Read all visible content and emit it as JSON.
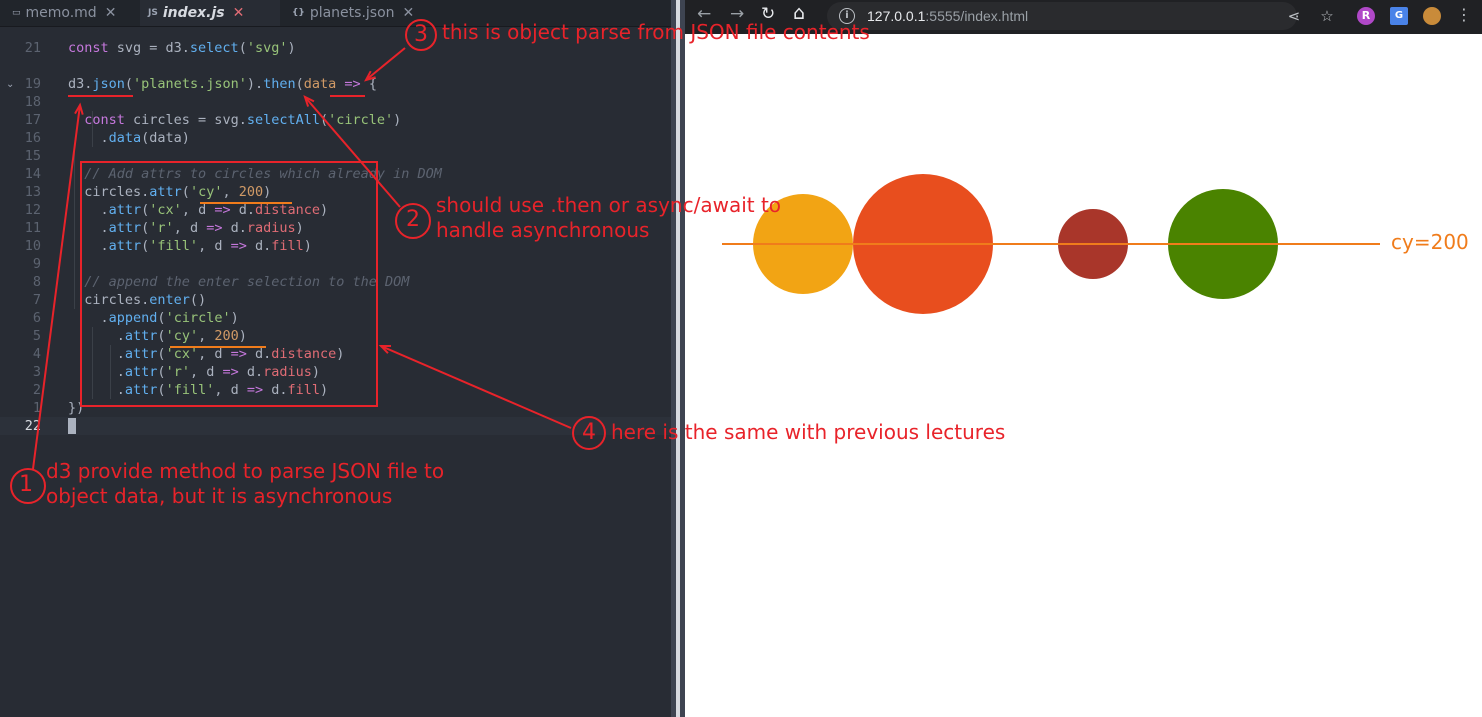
{
  "editor": {
    "tabs": [
      {
        "icon": "md-file-icon",
        "glyph": "▭",
        "label": "memo.md"
      },
      {
        "icon": "js-file-icon",
        "glyph": "JS",
        "label": "index.js"
      },
      {
        "icon": "json-file-icon",
        "glyph": "{}",
        "label": "planets.json"
      }
    ],
    "close_glyph": "✕",
    "lines": [
      {
        "num": "21",
        "html": "<span class=\"k\">const</span> svg = d3.<span class=\"f\">select</span>(<span class=\"s\">'svg'</span>)"
      },
      {
        "num": "",
        "html": ""
      },
      {
        "num": "19",
        "html": "d3.<span class=\"f\">json</span>(<span class=\"s\">'planets.json'</span>).<span class=\"f\">then</span>(<span class=\"n\">data</span> <span class=\"k\">=></span> {"
      },
      {
        "num": "18",
        "html": ""
      },
      {
        "num": "17",
        "html": "  <span class=\"k\">const</span> circles = svg.<span class=\"f\">selectAll</span>(<span class=\"s\">'circle'</span>)"
      },
      {
        "num": "16",
        "html": "    .<span class=\"f\">data</span>(data)"
      },
      {
        "num": "15",
        "html": ""
      },
      {
        "num": "14",
        "html": "  <span class=\"c\">// Add attrs to circles which already in DOM</span>"
      },
      {
        "num": "13",
        "html": "  circles.<span class=\"f\">attr</span>(<span class=\"s\">'cy'</span>, <span class=\"n\">200</span>)"
      },
      {
        "num": "12",
        "html": "    .<span class=\"f\">attr</span>(<span class=\"s\">'cx'</span>, d <span class=\"k\">=></span> d.<span class=\"p\">distance</span>)"
      },
      {
        "num": "11",
        "html": "    .<span class=\"f\">attr</span>(<span class=\"s\">'r'</span>, d <span class=\"k\">=></span> d.<span class=\"p\">radius</span>)"
      },
      {
        "num": "10",
        "html": "    .<span class=\"f\">attr</span>(<span class=\"s\">'fill'</span>, d <span class=\"k\">=></span> d.<span class=\"p\">fill</span>)"
      },
      {
        "num": "9",
        "html": ""
      },
      {
        "num": "8",
        "html": "  <span class=\"c\">// append the enter selection to the DOM</span>"
      },
      {
        "num": "7",
        "html": "  circles.<span class=\"f\">enter</span>()"
      },
      {
        "num": "6",
        "html": "    .<span class=\"f\">append</span>(<span class=\"s\">'circle'</span>)"
      },
      {
        "num": "5",
        "html": "      .<span class=\"f\">attr</span>(<span class=\"s\">'cy'</span>, <span class=\"n\">200</span>)"
      },
      {
        "num": "4",
        "html": "      .<span class=\"f\">attr</span>(<span class=\"s\">'cx'</span>, d <span class=\"k\">=></span> d.<span class=\"p\">distance</span>)"
      },
      {
        "num": "3",
        "html": "      .<span class=\"f\">attr</span>(<span class=\"s\">'r'</span>, d <span class=\"k\">=></span> d.<span class=\"p\">radius</span>)"
      },
      {
        "num": "2",
        "html": "      .<span class=\"f\">attr</span>(<span class=\"s\">'fill'</span>, d <span class=\"k\">=></span> d.<span class=\"p\">fill</span>)"
      },
      {
        "num": "1",
        "html": "})"
      },
      {
        "num": "22",
        "html": "<span class=\"cursor\"></span>",
        "current": true
      }
    ]
  },
  "browser": {
    "back_glyph": "←",
    "forward_glyph": "→",
    "reload_glyph": "↻",
    "home_glyph": "⌂",
    "url_host": "127.0.0.1",
    "url_rest": ":5555/index.html",
    "info_glyph": "i",
    "share_glyph": "⋖",
    "star_glyph": "☆",
    "circles": [
      {
        "fill": "#f2a414"
      },
      {
        "fill": "#e84e1e"
      },
      {
        "fill": "#a9362a"
      },
      {
        "fill": "#4a8300"
      }
    ],
    "cy_label": "cy=200"
  },
  "annotations": [
    {
      "id": "1",
      "lines": [
        "d3 provide method to parse JSON file to",
        "object data, but it is asynchronous"
      ]
    },
    {
      "id": "2",
      "lines": [
        "should use .then or async/await to",
        "handle asynchronous"
      ]
    },
    {
      "id": "3",
      "lines": [
        "this is object parse from JSON file contents"
      ]
    },
    {
      "id": "4",
      "lines": [
        "here is the same with previous lectures"
      ]
    }
  ],
  "colors": {
    "annotation": "#e8232a",
    "highlight_underline": "#f07c1b"
  }
}
